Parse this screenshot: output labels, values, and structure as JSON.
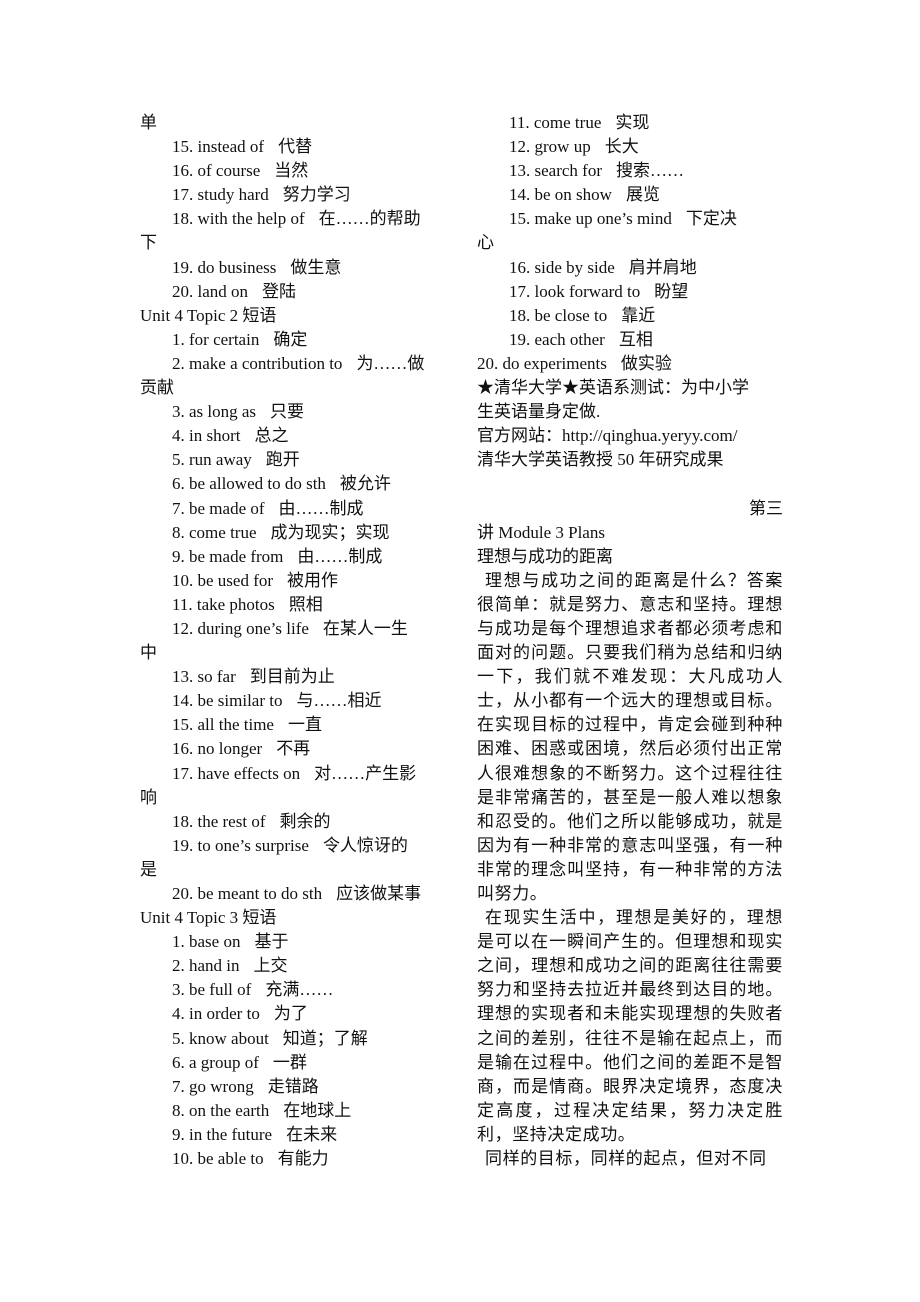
{
  "left_column": {
    "lines": [
      {
        "type": "wrap",
        "text": "单"
      },
      {
        "type": "item",
        "en": "15. instead of",
        "zh": "代替"
      },
      {
        "type": "item",
        "en": "16. of course",
        "zh": "当然"
      },
      {
        "type": "item",
        "en": "17. study hard",
        "zh": "努力学习"
      },
      {
        "type": "item",
        "en": "18. with the help of",
        "zh": "在……的帮助"
      },
      {
        "type": "wrap",
        "text": "下"
      },
      {
        "type": "item",
        "en": "19. do business",
        "zh": "做生意"
      },
      {
        "type": "item",
        "en": "20. land on",
        "zh": "登陆"
      },
      {
        "type": "heading",
        "text": "Unit 4 Topic 2 短语"
      },
      {
        "type": "item",
        "en": "1. for certain",
        "zh": "确定"
      },
      {
        "type": "item",
        "en": "2. make a contribution to",
        "zh": "为……做"
      },
      {
        "type": "wrap",
        "text": "贡献"
      },
      {
        "type": "item",
        "en": "3. as long as",
        "zh": "只要"
      },
      {
        "type": "item",
        "en": "4. in short",
        "zh": "总之"
      },
      {
        "type": "item",
        "en": "5. run away",
        "zh": "跑开"
      },
      {
        "type": "item",
        "en": "6. be allowed to do sth",
        "zh": "被允许"
      },
      {
        "type": "item",
        "en": "7. be made of",
        "zh": "由……制成"
      },
      {
        "type": "item",
        "en": "8. come true",
        "zh": "成为现实；实现"
      },
      {
        "type": "item",
        "en": "9. be made from",
        "zh": "由……制成"
      },
      {
        "type": "item",
        "en": "10. be used for",
        "zh": "被用作"
      },
      {
        "type": "item",
        "en": "11. take photos",
        "zh": "照相"
      },
      {
        "type": "item",
        "en": "12. during one’s life",
        "zh": "在某人一生"
      },
      {
        "type": "wrap",
        "text": "中"
      },
      {
        "type": "item",
        "en": "13. so far",
        "zh": "到目前为止"
      },
      {
        "type": "item",
        "en": "14. be similar to",
        "zh": "与……相近"
      },
      {
        "type": "item",
        "en": "15. all the time",
        "zh": "一直"
      },
      {
        "type": "item",
        "en": "16. no longer",
        "zh": "不再"
      },
      {
        "type": "item",
        "en": "17. have effects on",
        "zh": "对……产生影"
      },
      {
        "type": "wrap",
        "text": "响"
      },
      {
        "type": "item",
        "en": "18. the rest of",
        "zh": "剩余的"
      },
      {
        "type": "item",
        "en": "19. to one’s surprise",
        "zh": "令人惊讶的"
      },
      {
        "type": "wrap",
        "text": "是"
      },
      {
        "type": "item",
        "en": "20. be meant to do sth",
        "zh": "应该做某事"
      },
      {
        "type": "heading",
        "text": "Unit 4 Topic 3 短语"
      },
      {
        "type": "item",
        "en": "1. base on",
        "zh": "基于"
      },
      {
        "type": "item",
        "en": "2. hand in",
        "zh": "上交"
      },
      {
        "type": "item",
        "en": "3. be full of",
        "zh": "充满……"
      },
      {
        "type": "item",
        "en": "4. in order to",
        "zh": "为了"
      },
      {
        "type": "item",
        "en": "5. know about",
        "zh": "知道；了解"
      },
      {
        "type": "item",
        "en": "6. a group of",
        "zh": "一群"
      },
      {
        "type": "item",
        "en": "7. go wrong",
        "zh": "走错路"
      },
      {
        "type": "item",
        "en": "8. on the earth",
        "zh": "在地球上"
      },
      {
        "type": "item",
        "en": "9. in the future",
        "zh": "在未来"
      },
      {
        "type": "item",
        "en": "10. be able to",
        "zh": "有能力"
      }
    ]
  },
  "right_column": {
    "lines": [
      {
        "type": "item",
        "en": "11. come true",
        "zh": "实现"
      },
      {
        "type": "item",
        "en": "12. grow up",
        "zh": "长大"
      },
      {
        "type": "item",
        "en": "13. search for",
        "zh": "搜索……"
      },
      {
        "type": "item",
        "en": "14. be on show",
        "zh": "展览"
      },
      {
        "type": "item",
        "en": "15. make up one’s mind",
        "zh": "下定决"
      },
      {
        "type": "wrap",
        "text": "心"
      },
      {
        "type": "item",
        "en": "16. side by side",
        "zh": "肩并肩地"
      },
      {
        "type": "item",
        "en": "17. look forward to",
        "zh": "盼望"
      },
      {
        "type": "item",
        "en": "18. be close to",
        "zh": "靠近"
      },
      {
        "type": "item",
        "en": "19. each other",
        "zh": "互相"
      },
      {
        "type": "item-flush",
        "en": "20. do experiments",
        "zh": "做实验"
      }
    ],
    "ad": {
      "line1": "★清华大学★英语系测试：为中小学",
      "line2": "生英语量身定做.",
      "line3": "官方网站：http://qinghua.yeryy.com/",
      "line4": "清华大学英语教授 50 年研究成果"
    },
    "lecture": {
      "number_part1": "第三",
      "number_part2": "讲 Module 3 Plans",
      "title": "理想与成功的距离",
      "paragraphs": [
        "理想与成功之间的距离是什么？答案很简单：就是努力、意志和坚持。理想与成功是每个理想追求者都必须考虑和面对的问题。只要我们稍为总结和归纳一下，我们就不难发现：大凡成功人士，从小都有一个远大的理想或目标。在实现目标的过程中，肯定会碰到种种困难、困惑或困境，然后必须付出正常人很难想象的不断努力。这个过程往往是非常痛苦的，甚至是一般人难以想象和忍受的。他们之所以能够成功，就是因为有一种非常的意志叫坚强，有一种非常的理念叫坚持，有一种非常的方法叫努力。",
        "在现实生活中，理想是美好的，理想是可以在一瞬间产生的。但理想和现实之间，理想和成功之间的距离往往需要努力和坚持去拉近并最终到达目的地。理想的实现者和未能实现理想的失败者之间的差别，往往不是输在起点上，而是输在过程中。他们之间的差距不是智商，而是情商。眼界决定境界，态度决定高度，过程决定结果，努力决定胜利，坚持决定成功。",
        "同样的目标，同样的起点，但对不同"
      ]
    }
  }
}
